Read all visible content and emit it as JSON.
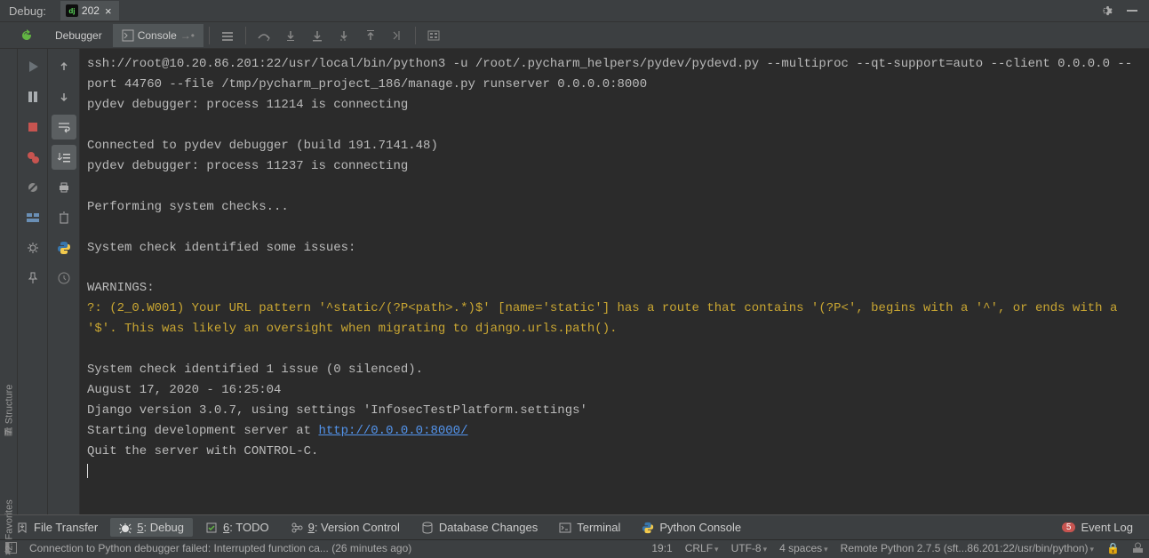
{
  "topbar": {
    "label": "Debug:",
    "run_config": "202"
  },
  "subtoolbar": {
    "tab_debugger": "Debugger",
    "tab_console": "Console"
  },
  "console": {
    "l1": "ssh://root@10.20.86.201:22/usr/local/bin/python3 -u /root/.pycharm_helpers/pydev/pydevd.py --multiproc --qt-support=auto --client 0.0.0.0 --port 44760 --file /tmp/pycharm_project_186/manage.py runserver 0.0.0.0:8000",
    "l2": "pydev debugger: process 11214 is connecting",
    "l3": "",
    "l4": "Connected to pydev debugger (build 191.7141.48)",
    "l5": "pydev debugger: process 11237 is connecting",
    "l6": "",
    "l7": "Performing system checks...",
    "l8": "",
    "l9": "System check identified some issues:",
    "l10": "",
    "l11": "WARNINGS:",
    "warn": "?: (2_0.W001) Your URL pattern '^static/(?P<path>.*)$' [name='static'] has a route that contains '(?P<', begins with a '^', or ends with a '$'. This was likely an oversight when migrating to django.urls.path().",
    "l12": "",
    "l13": "System check identified 1 issue (0 silenced).",
    "l14": "August 17, 2020 - 16:25:04",
    "l15": "Django version 3.0.7, using settings 'InfosecTestPlatform.settings'",
    "l16_prefix": "Starting development server at ",
    "l16_link": "http://0.0.0.0:8000/",
    "l17": "Quit the server with CONTROL-C."
  },
  "bottom_tools": {
    "file_transfer": "File Transfer",
    "debug_key": "5",
    "debug_label": ": Debug",
    "todo_key": "6",
    "todo_label": ": TODO",
    "vcs_key": "9",
    "vcs_label": ": Version Control",
    "db_changes": "Database Changes",
    "terminal": "Terminal",
    "python_console": "Python Console",
    "event_count": "5",
    "event_log": "Event Log"
  },
  "status": {
    "message": "Connection to Python debugger failed: Interrupted function ca... (26 minutes ago)",
    "pos": "19:1",
    "crlf": "CRLF",
    "encoding": "UTF-8",
    "indent": "4 spaces",
    "interpreter": "Remote Python 2.7.5 (sft...86.201:22/usr/bin/python)"
  },
  "sidebar_labels": {
    "structure": "7: Structure",
    "favorites": "2: Favorites"
  }
}
